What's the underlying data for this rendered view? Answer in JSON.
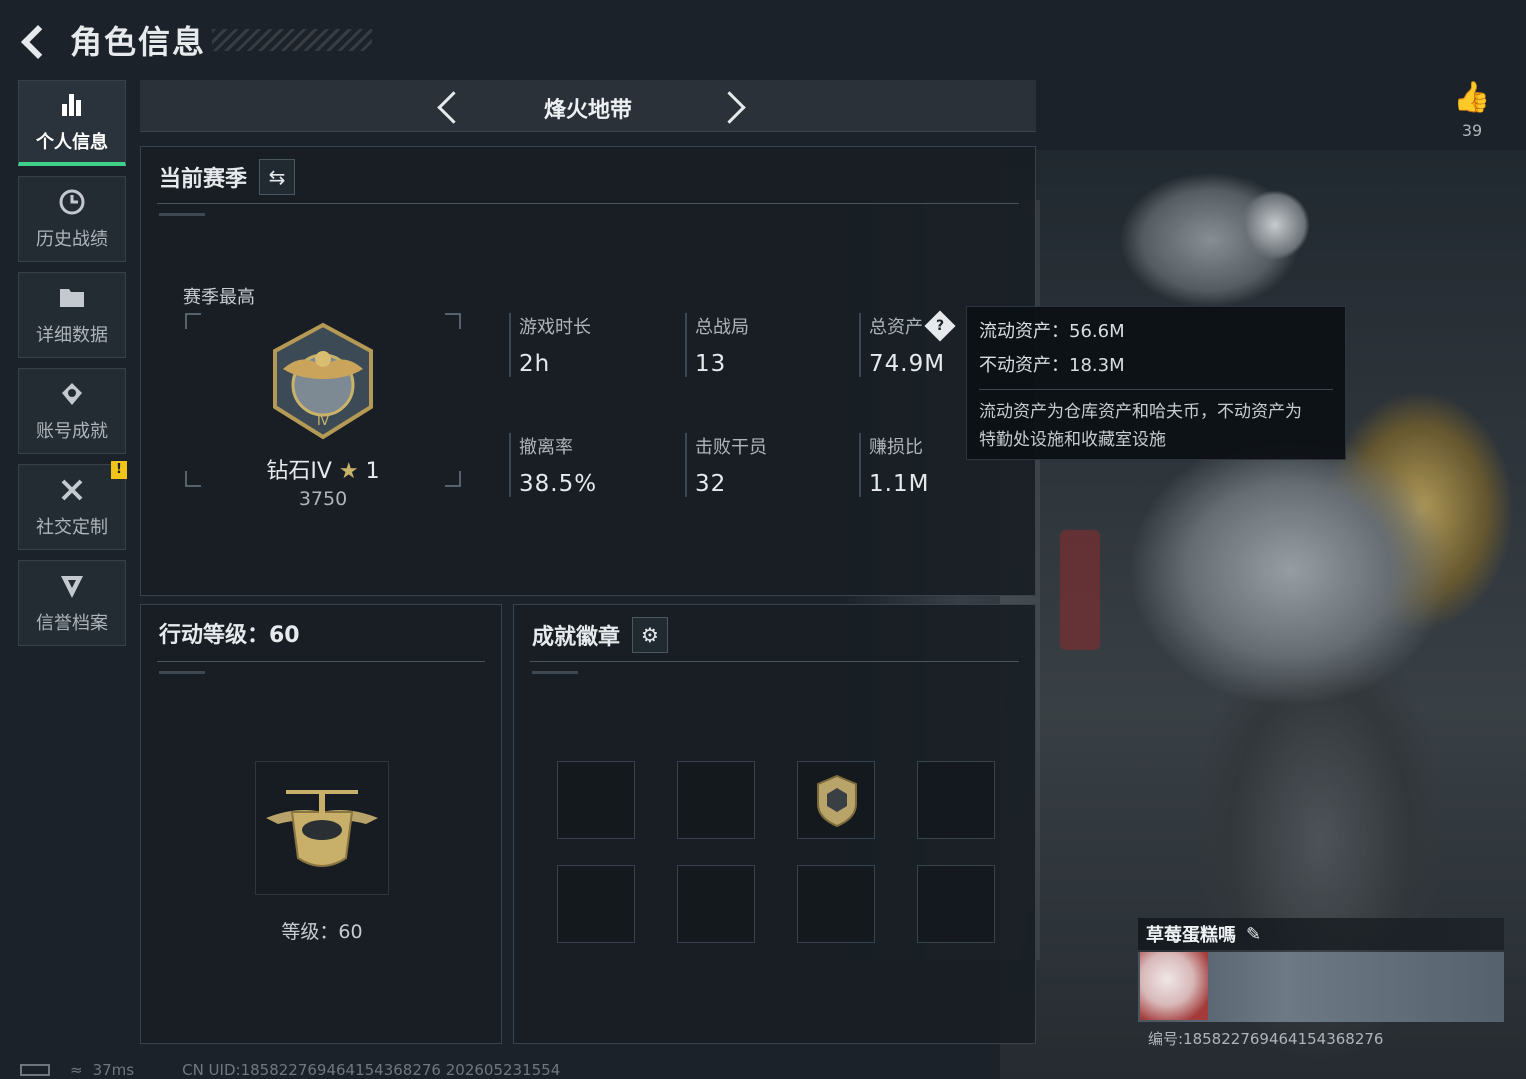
{
  "header": {
    "title": "角色信息"
  },
  "like": {
    "count": "39"
  },
  "sidebar": {
    "items": [
      {
        "label": "个人信息",
        "icon": "bar-chart-icon"
      },
      {
        "label": "历史战绩",
        "icon": "history-icon"
      },
      {
        "label": "详细数据",
        "icon": "folder-icon"
      },
      {
        "label": "账号成就",
        "icon": "achievement-icon"
      },
      {
        "label": "社交定制",
        "icon": "tools-icon",
        "badge": "!"
      },
      {
        "label": "信誉档案",
        "icon": "reputation-icon"
      }
    ]
  },
  "mode": {
    "title": "烽火地带"
  },
  "season": {
    "title": "当前赛季",
    "best_label": "赛季最高",
    "rank_name": "钻石IV",
    "rank_stars": "1",
    "rank_score": "3750",
    "stats": [
      {
        "label": "游戏时长",
        "value": "2h"
      },
      {
        "label": "总战局",
        "value": "13"
      },
      {
        "label": "总资产",
        "value": "74.9M"
      },
      {
        "label": "撤离率",
        "value": "38.5%"
      },
      {
        "label": "击败干员",
        "value": "32"
      },
      {
        "label": "赚损比",
        "value": "1.1M"
      }
    ]
  },
  "tooltip": {
    "liquid": "流动资产：56.6M",
    "fixed": "不动资产：18.3M",
    "note_line1": "流动资产为仓库资产和哈夫币，不动资产为",
    "note_line2": "特勤处设施和收藏室设施"
  },
  "level": {
    "title": "行动等级：60",
    "text": "等级：60"
  },
  "achievements": {
    "title": "成就徽章"
  },
  "profile": {
    "name": "草莓蛋糕嗎",
    "id": "编号:185822769464154368276"
  },
  "footer": {
    "ping": "37ms",
    "uid": "CN UID:185822769464154368276 202605231554"
  },
  "colors": {
    "accent": "#3fd08a",
    "badge": "#f0c419",
    "gold": "#c9b36a"
  }
}
